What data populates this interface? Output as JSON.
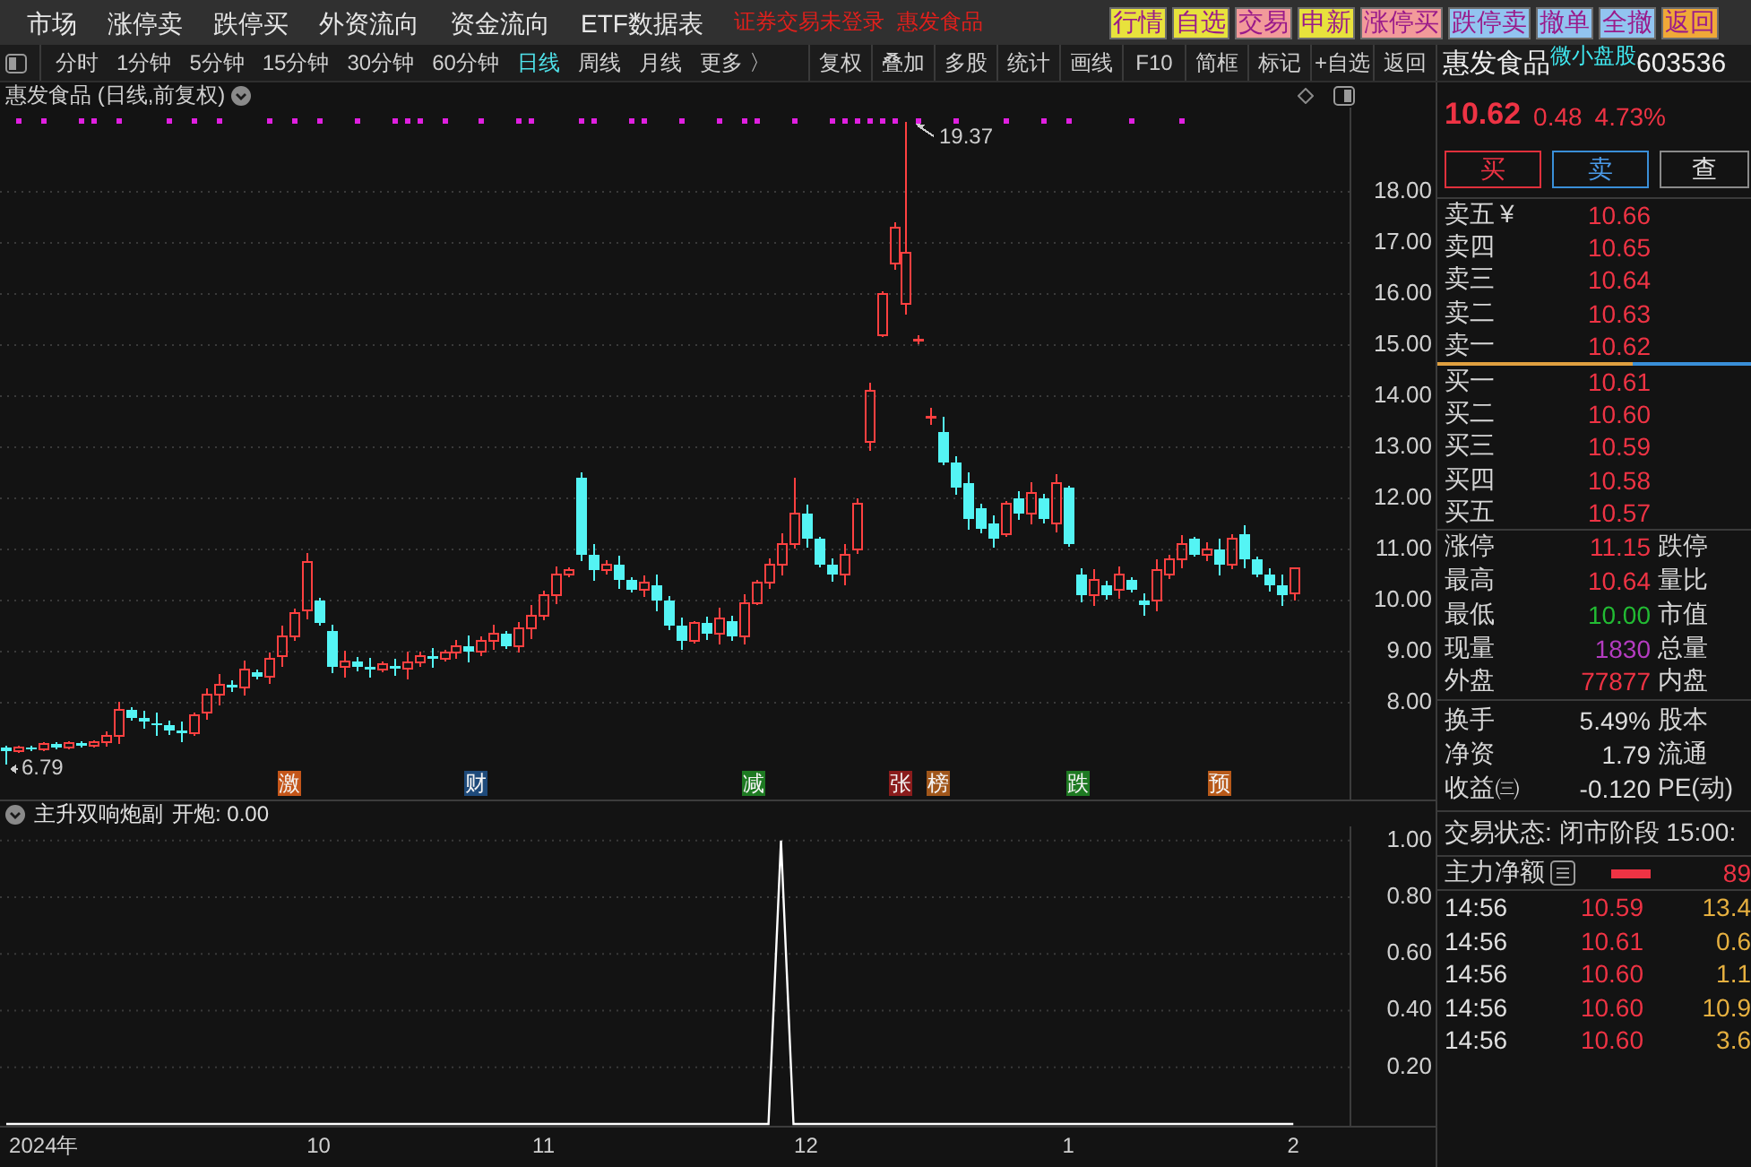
{
  "top_bar": {
    "menu": [
      "市场",
      "涨停卖",
      "跌停买",
      "外资流向",
      "资金流向",
      "ETF数据表"
    ],
    "login_status": "证券交易未登录",
    "stock_name": "惠发食品",
    "quick_buttons": [
      {
        "label": "行情",
        "color": "#e8e23c"
      },
      {
        "label": "自选",
        "color": "#e8e23c"
      },
      {
        "label": "交易",
        "color": "#f29a9a"
      },
      {
        "label": "申新",
        "color": "#e8e23c"
      },
      {
        "label": "涨停买",
        "color": "#f29a9a"
      },
      {
        "label": "跌停卖",
        "color": "#92c4f0"
      },
      {
        "label": "撤单",
        "color": "#92c4f0"
      },
      {
        "label": "全撤",
        "color": "#92c4f0"
      },
      {
        "label": "返回",
        "color": "#f0a838"
      }
    ]
  },
  "toolbar": {
    "periods": [
      {
        "label": "分时",
        "selected": false
      },
      {
        "label": "1分钟",
        "selected": false
      },
      {
        "label": "5分钟",
        "selected": false
      },
      {
        "label": "15分钟",
        "selected": false
      },
      {
        "label": "30分钟",
        "selected": false
      },
      {
        "label": "60分钟",
        "selected": false
      },
      {
        "label": "日线",
        "selected": true
      },
      {
        "label": "周线",
        "selected": false
      },
      {
        "label": "月线",
        "selected": false
      }
    ],
    "more": "更多 〉",
    "tools": [
      "复权",
      "叠加",
      "多股",
      "统计",
      "画线",
      "F10",
      "简框",
      "标记",
      "+自选",
      "返回"
    ]
  },
  "price_chart": {
    "title": "惠发食品 (日线,前复权)",
    "high_label": "19.37",
    "low_label": "6.79",
    "chart_data": {
      "type": "candlestick",
      "categories": [
        null,
        null,
        null,
        null,
        null,
        null,
        null,
        null,
        null,
        null,
        null,
        null,
        null,
        null,
        null,
        null,
        null,
        null,
        null,
        null,
        null,
        null,
        null,
        null,
        null,
        null,
        null,
        null,
        null,
        null,
        null,
        null,
        null,
        null,
        null,
        null,
        null,
        null,
        null,
        null,
        null,
        null,
        null,
        null,
        null,
        null,
        null,
        null,
        null,
        null,
        null,
        null,
        null,
        null,
        null,
        null,
        null,
        null,
        null,
        null,
        null,
        null,
        null,
        null,
        null,
        null,
        null,
        null,
        null,
        null,
        null,
        null,
        null,
        null,
        null,
        null,
        null,
        null,
        null,
        null,
        null,
        null,
        null,
        null,
        null,
        null,
        null,
        null,
        null,
        null,
        null,
        null,
        null,
        null,
        null,
        null,
        null,
        null,
        null,
        null,
        null,
        null,
        null,
        null,
        null,
        null,
        null,
        null
      ],
      "ohlc": [
        [
          7.12,
          7.16,
          6.79,
          7.05
        ],
        [
          7.05,
          7.16,
          7.01,
          7.12
        ],
        [
          7.12,
          7.16,
          7.04,
          7.08
        ],
        [
          7.08,
          7.22,
          7.04,
          7.18
        ],
        [
          7.18,
          7.22,
          7.08,
          7.12
        ],
        [
          7.12,
          7.24,
          7.08,
          7.2
        ],
        [
          7.2,
          7.24,
          7.11,
          7.15
        ],
        [
          7.15,
          7.26,
          7.11,
          7.22
        ],
        [
          7.22,
          7.44,
          7.13,
          7.35
        ],
        [
          7.35,
          8.02,
          7.18,
          7.85
        ],
        [
          7.85,
          7.9,
          7.65,
          7.7
        ],
        [
          7.7,
          7.83,
          7.49,
          7.62
        ],
        [
          7.6,
          7.81,
          7.34,
          7.55
        ],
        [
          7.55,
          7.64,
          7.36,
          7.45
        ],
        [
          7.45,
          7.62,
          7.23,
          7.4
        ],
        [
          7.4,
          7.8,
          7.35,
          7.75
        ],
        [
          7.8,
          8.28,
          7.67,
          8.15
        ],
        [
          8.15,
          8.56,
          7.94,
          8.35
        ],
        [
          8.35,
          8.44,
          8.21,
          8.3
        ],
        [
          8.3,
          8.82,
          8.13,
          8.65
        ],
        [
          8.6,
          8.65,
          8.45,
          8.5
        ],
        [
          8.5,
          8.98,
          8.37,
          8.85
        ],
        [
          8.9,
          9.51,
          8.69,
          9.3
        ],
        [
          9.3,
          9.84,
          9.21,
          9.75
        ],
        [
          9.8,
          10.92,
          9.63,
          10.75
        ],
        [
          10,
          10.05,
          9.5,
          9.55
        ],
        [
          9.4,
          9.53,
          8.57,
          8.7
        ],
        [
          8.7,
          9.01,
          8.49,
          8.8
        ],
        [
          8.8,
          8.89,
          8.61,
          8.7
        ],
        [
          8.7,
          8.87,
          8.48,
          8.65
        ],
        [
          8.65,
          8.8,
          8.6,
          8.75
        ],
        [
          8.72,
          8.85,
          8.53,
          8.66
        ],
        [
          8.66,
          8.99,
          8.45,
          8.78
        ],
        [
          8.78,
          8.99,
          8.69,
          8.9
        ],
        [
          8.9,
          9.07,
          8.68,
          8.85
        ],
        [
          8.85,
          9.03,
          8.8,
          8.98
        ],
        [
          8.98,
          9.23,
          8.85,
          9.1
        ],
        [
          9.1,
          9.31,
          8.79,
          9
        ],
        [
          9,
          9.29,
          8.91,
          9.2
        ],
        [
          9.2,
          9.52,
          9.03,
          9.35
        ],
        [
          9.35,
          9.4,
          9.05,
          9.1
        ],
        [
          9.1,
          9.58,
          8.97,
          9.45
        ],
        [
          9.45,
          9.91,
          9.24,
          9.7
        ],
        [
          9.7,
          10.19,
          9.61,
          10.1
        ],
        [
          10.1,
          10.67,
          9.93,
          10.5
        ],
        [
          10.5,
          10.65,
          10.45,
          10.6
        ],
        [
          12.4,
          12.5,
          10.77,
          10.9
        ],
        [
          10.9,
          11.11,
          10.39,
          10.6
        ],
        [
          10.6,
          10.79,
          10.51,
          10.7
        ],
        [
          10.7,
          10.87,
          10.23,
          10.4
        ],
        [
          10.4,
          10.45,
          10.15,
          10.2
        ],
        [
          10.2,
          10.48,
          10.07,
          10.35
        ],
        [
          10.3,
          10.51,
          9.79,
          10
        ],
        [
          10,
          10.09,
          9.41,
          9.5
        ],
        [
          9.5,
          9.67,
          9.03,
          9.2
        ],
        [
          9.2,
          9.6,
          9.15,
          9.55
        ],
        [
          9.55,
          9.68,
          9.22,
          9.35
        ],
        [
          9.35,
          9.86,
          9.14,
          9.65
        ],
        [
          9.6,
          9.69,
          9.21,
          9.3
        ],
        [
          9.3,
          10.12,
          9.13,
          9.95
        ],
        [
          9.95,
          10.4,
          9.9,
          10.35
        ],
        [
          10.35,
          10.83,
          10.22,
          10.7
        ],
        [
          10.7,
          11.31,
          10.49,
          11.1
        ],
        [
          11.1,
          12.4,
          11.01,
          11.7
        ],
        [
          11.7,
          11.87,
          11.03,
          11.2
        ],
        [
          11.2,
          11.25,
          10.65,
          10.7
        ],
        [
          10.7,
          10.83,
          10.37,
          10.5
        ],
        [
          10.5,
          11.11,
          10.29,
          10.9
        ],
        [
          11,
          11.99,
          10.91,
          11.9
        ],
        [
          13.1,
          14.27,
          12.93,
          14.1
        ],
        [
          15.2,
          16.05,
          15.15,
          16
        ],
        [
          16.6,
          17.4,
          16.47,
          17.3
        ],
        [
          15.8,
          19.37,
          15.6,
          16.8
        ],
        [
          15.1,
          15.19,
          15.01,
          15.1
        ],
        [
          13.6,
          13.77,
          13.43,
          13.6
        ],
        [
          13.3,
          13.6,
          12.65,
          12.7
        ],
        [
          12.7,
          12.83,
          12.07,
          12.2
        ],
        [
          12.3,
          12.51,
          11.39,
          11.6
        ],
        [
          11.8,
          11.89,
          11.31,
          11.4
        ],
        [
          11.5,
          11.67,
          11.03,
          11.2
        ],
        [
          11.3,
          11.95,
          11.25,
          11.9
        ],
        [
          12,
          12.13,
          11.57,
          11.7
        ],
        [
          11.7,
          12.31,
          11.49,
          12.1
        ],
        [
          12,
          12.09,
          11.51,
          11.6
        ],
        [
          11.5,
          12.47,
          11.33,
          12.3
        ],
        [
          12.2,
          12.25,
          11.05,
          11.1
        ],
        [
          10.5,
          10.63,
          9.97,
          10.1
        ],
        [
          10.1,
          10.61,
          9.89,
          10.4
        ],
        [
          10.3,
          10.39,
          10.01,
          10.1
        ],
        [
          10.2,
          10.67,
          10.03,
          10.5
        ],
        [
          10.4,
          10.45,
          10.15,
          10.2
        ],
        [
          10,
          10.13,
          9.7,
          9.9
        ],
        [
          10,
          10.81,
          9.79,
          10.6
        ],
        [
          10.5,
          10.89,
          10.41,
          10.8
        ],
        [
          10.8,
          11.27,
          10.63,
          11.1
        ],
        [
          11.2,
          11.25,
          10.85,
          10.9
        ],
        [
          10.9,
          11.13,
          10.77,
          11
        ],
        [
          11,
          11.21,
          10.49,
          10.7
        ],
        [
          10.7,
          11.29,
          10.61,
          11.2
        ],
        [
          11.3,
          11.47,
          10.63,
          10.8
        ],
        [
          10.8,
          10.85,
          10.45,
          10.5
        ],
        [
          10.5,
          10.63,
          10.17,
          10.3
        ],
        [
          10.3,
          10.51,
          9.89,
          10.1
        ],
        [
          10.14,
          10.64,
          10,
          10.62
        ],
        null,
        null,
        null,
        null
      ],
      "ylim": [
        6.1,
        19.65
      ],
      "grid": true,
      "yticks": [
        {
          "value": 18,
          "label": "18.00"
        },
        {
          "value": 17,
          "label": "17.00"
        },
        {
          "value": 16,
          "label": "16.00"
        },
        {
          "value": 15,
          "label": "15.00"
        },
        {
          "value": 14,
          "label": "14.00"
        },
        {
          "value": 13,
          "label": "13.00"
        },
        {
          "value": 12,
          "label": "12.00"
        },
        {
          "value": 11,
          "label": "11.00"
        },
        {
          "value": 10,
          "label": "10.00"
        },
        {
          "value": 9,
          "label": "9.00"
        },
        {
          "value": 8,
          "label": "8.00"
        }
      ]
    },
    "events": [
      {
        "label": "激",
        "color": "#c4561a"
      },
      {
        "label": "财",
        "color": "#1e4a7a"
      },
      {
        "label": "减",
        "color": "#1e7a22"
      },
      {
        "label": "张",
        "color": "#8a1c1c"
      },
      {
        "label": "榜",
        "color": "#a0561a"
      },
      {
        "label": "跌",
        "color": "#1e7a22"
      },
      {
        "label": "预",
        "color": "#b85a1a"
      }
    ]
  },
  "indicator": {
    "name": "主升双响炮副",
    "reading": ": 0.00",
    "chart_data": {
      "type": "line",
      "categories": [
        null,
        null,
        null,
        "2024年",
        null,
        null,
        null,
        null,
        null,
        null,
        null,
        null,
        null,
        null,
        null,
        null,
        null,
        null,
        null,
        null,
        null,
        null,
        null,
        null,
        null,
        "10",
        null,
        null,
        null,
        null,
        null,
        null,
        null,
        null,
        null,
        null,
        null,
        null,
        null,
        null,
        null,
        null,
        null,
        "11",
        null,
        null,
        null,
        null,
        null,
        null,
        null,
        null,
        null,
        null,
        null,
        null,
        null,
        null,
        null,
        null,
        null,
        null,
        null,
        null,
        "12",
        null,
        null,
        null,
        null,
        null,
        null,
        null,
        null,
        null,
        null,
        null,
        null,
        null,
        null,
        null,
        null,
        null,
        null,
        null,
        null,
        "1",
        null,
        null,
        null,
        null,
        null,
        null,
        null,
        null,
        null,
        null,
        null,
        null,
        null,
        null,
        null,
        null,
        null,
        "2",
        null,
        null,
        null,
        null
      ],
      "series": [
        {
          "name": "开炮",
          "color": "#ffffff",
          "values": [
            0,
            0,
            0,
            0,
            0,
            0,
            0,
            0,
            0,
            0,
            0,
            0,
            0,
            0,
            0,
            0,
            0,
            0,
            0,
            0,
            0,
            0,
            0,
            0,
            0,
            0,
            0,
            0,
            0,
            0,
            0,
            0,
            0,
            0,
            0,
            0,
            0,
            0,
            0,
            0,
            0,
            0,
            0,
            0,
            0,
            0,
            0,
            0,
            0,
            0,
            0,
            0,
            0,
            0,
            0,
            0,
            0,
            0,
            0,
            0,
            0,
            0,
            1,
            0,
            0,
            0,
            0,
            0,
            0,
            0,
            0,
            0,
            0,
            0,
            0,
            0,
            0,
            0,
            0,
            0,
            0,
            0,
            0,
            0,
            0,
            0,
            0,
            0,
            0,
            0,
            0,
            0,
            0,
            0,
            0,
            0,
            0,
            0,
            0,
            0,
            0,
            0,
            0,
            0,
            null,
            null,
            null,
            null
          ]
        }
      ],
      "ylim": [
        0,
        1.05
      ],
      "grid": true,
      "yticks": [
        {
          "value": 1,
          "label": "1.00"
        },
        {
          "value": 0.8,
          "label": "0.80"
        },
        {
          "value": 0.6,
          "label": "0.60"
        },
        {
          "value": 0.4,
          "label": "0.40"
        },
        {
          "value": 0.2,
          "label": "0.20"
        }
      ]
    }
  },
  "quote": {
    "name": "惠发食品",
    "tag": "微小盘股",
    "code": "603536",
    "price": "10.62",
    "change": "0.48",
    "change_pct": "4.73%",
    "buttons": [
      {
        "label": "买",
        "kind": "buy"
      },
      {
        "label": "卖",
        "kind": "sell"
      },
      {
        "label": "查",
        "kind": "query"
      }
    ],
    "asks": [
      {
        "label": "卖五",
        "note": "¥",
        "price": "10.66"
      },
      {
        "label": "卖四",
        "price": "10.65"
      },
      {
        "label": "卖三",
        "price": "10.64"
      },
      {
        "label": "卖二",
        "price": "10.63"
      },
      {
        "label": "卖一",
        "price": "10.62"
      }
    ],
    "ratio_bar": {
      "level": 0.62
    },
    "bids": [
      {
        "label": "买一",
        "price": "10.61"
      },
      {
        "label": "买二",
        "price": "10.60"
      },
      {
        "label": "买三",
        "price": "10.59"
      },
      {
        "label": "买四",
        "price": "10.58"
      },
      {
        "label": "买五",
        "price": "10.57"
      }
    ],
    "market_stats": [
      {
        "label": "涨停",
        "value": "11.15",
        "color": "#ee3344",
        "label2": "跌停"
      },
      {
        "label": "最高",
        "value": "10.64",
        "color": "#ee3344",
        "label2": "量比"
      },
      {
        "label": "最低",
        "value": "10.00",
        "color": "#22bb33",
        "label2": "市值"
      },
      {
        "label": "现量",
        "value": "1830",
        "color": "#b43cc0",
        "label2": "总量"
      },
      {
        "label": "外盘",
        "value": "77877",
        "color": "#ee3344",
        "label2": "内盘"
      }
    ],
    "fundamentals": [
      {
        "label": "换手",
        "value": "5.49%",
        "color": "#dddddd",
        "label2": "股本"
      },
      {
        "label": "净资",
        "value": "1.79",
        "color": "#dddddd",
        "label2": "流通"
      },
      {
        "label": "收益㈢",
        "value": "-0.120",
        "color": "#dddddd",
        "label2": "PE(动)"
      }
    ],
    "trade_status": "交易状态: 闭市阶段 15:00:",
    "net_flow": {
      "label": "主力净额",
      "value": "89"
    },
    "trades": [
      {
        "time": "14:56",
        "price": "10.59",
        "volume": "13.4"
      },
      {
        "time": "14:56",
        "price": "10.61",
        "volume": "0.6"
      },
      {
        "time": "14:56",
        "price": "10.60",
        "volume": "1.1"
      },
      {
        "time": "14:56",
        "price": "10.60",
        "volume": "10.9"
      },
      {
        "time": "14:56",
        "price": "10.60",
        "volume": "3.6"
      }
    ]
  }
}
